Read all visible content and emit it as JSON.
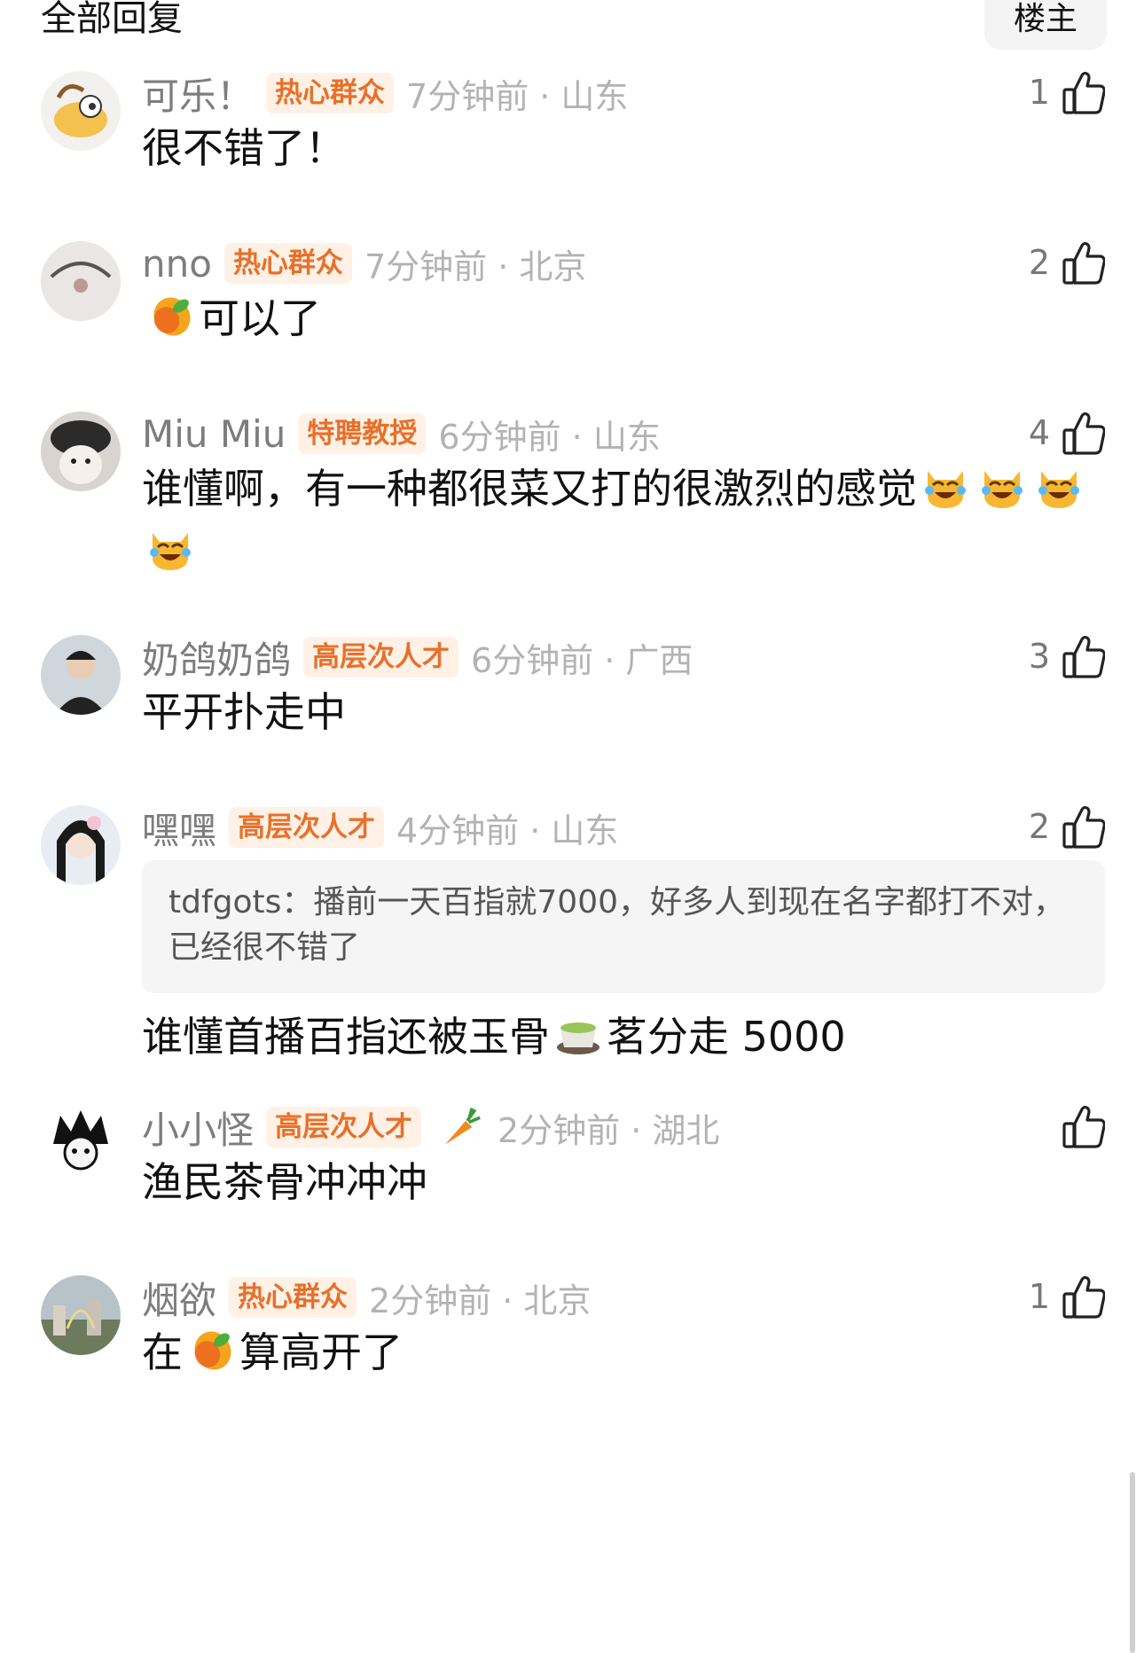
{
  "header": {
    "title": "全部回复",
    "button": "楼主"
  },
  "colors": {
    "badge_bg": "#fff1e6",
    "badge_text": "#e8702a",
    "meta_text": "#b3b3b3",
    "name_text": "#7d7d7d"
  },
  "comments": [
    {
      "name": "可乐！",
      "badge": "热心群众",
      "time": "7分钟前 · 山东",
      "likes": "1",
      "text": "很不错了！"
    },
    {
      "name": "nno",
      "badge": "热心群众",
      "time": "7分钟前 · 北京",
      "likes": "2",
      "text": "可以了",
      "emoji_prefix": "mango-emoji"
    },
    {
      "name": "Miu Miu",
      "badge": "特聘教授",
      "time": "6分钟前 · 山东",
      "likes": "4",
      "text": "谁懂啊，有一种都很菜又打的很激烈的感觉",
      "emoji_suffix": "crying-laughing-cat-emoji"
    },
    {
      "name": "奶鸽奶鸽",
      "badge": "高层次人才",
      "time": "6分钟前 · 广西",
      "likes": "3",
      "text": "平开扑走中"
    },
    {
      "name": "嘿嘿",
      "badge": "高层次人才",
      "time": "4分钟前 · 山东",
      "likes": "2",
      "quote": "tdfgots：播前一天百指就7000，好多人到现在名字都打不对，已经很不错了",
      "text_before": "谁懂首播百指还被玉骨",
      "text_after": "茗分走 5000",
      "emoji_mid": "tea-emoji"
    },
    {
      "name": "小小怪",
      "badge": "高层次人才",
      "time": "2分钟前 · 湖北",
      "likes": "",
      "text": "渔民茶骨冲冲冲",
      "badge_extra": "carrot-emoji"
    },
    {
      "name": "烟欲",
      "badge": "热心群众",
      "time": "2分钟前 · 北京",
      "likes": "1",
      "text_before": "在",
      "text_after": "算高开了",
      "emoji_mid": "mango-emoji"
    }
  ]
}
